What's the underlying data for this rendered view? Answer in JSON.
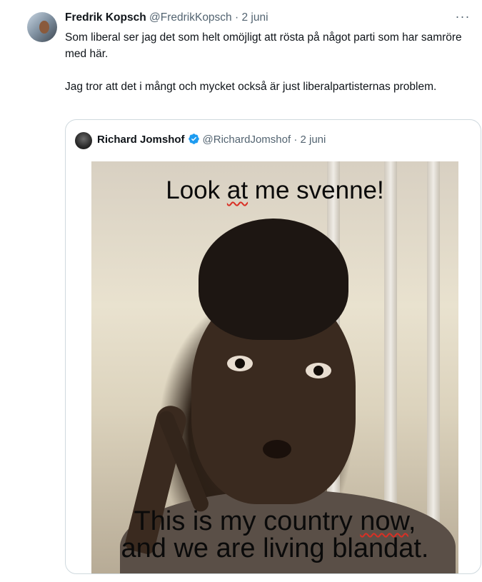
{
  "tweet": {
    "author_name": "Fredrik Kopsch",
    "author_handle": "@FredrikKopsch",
    "separator": "·",
    "date": "2 juni",
    "more_label": "···",
    "paragraphs": [
      "Som liberal ser jag det som helt omöjligt att rösta på något parti som har samröre med här.",
      "Jag tror att det i mångt och mycket också är just liberalpartisternas problem."
    ]
  },
  "quoted_tweet": {
    "author_name": "Richard Jomshof",
    "author_handle": "@RichardJomshof",
    "separator": "·",
    "date": "2 juni",
    "verified": true,
    "meme": {
      "top_text_before": "Look ",
      "top_text_flag": "at",
      "top_text_after": " me svenne!",
      "bottom_line1_before": "This is my country ",
      "bottom_line1_flag": "now",
      "bottom_line1_after": ",",
      "bottom_line2": "and we are living blandat."
    }
  },
  "colors": {
    "text_primary": "#0f1419",
    "text_secondary": "#536471",
    "border": "#cfd9de",
    "verified_blue": "#1d9bf0",
    "spellcheck_underline": "#d93025"
  },
  "icons": {
    "more": "more-horizontal-icon",
    "verified": "verified-badge-icon"
  }
}
